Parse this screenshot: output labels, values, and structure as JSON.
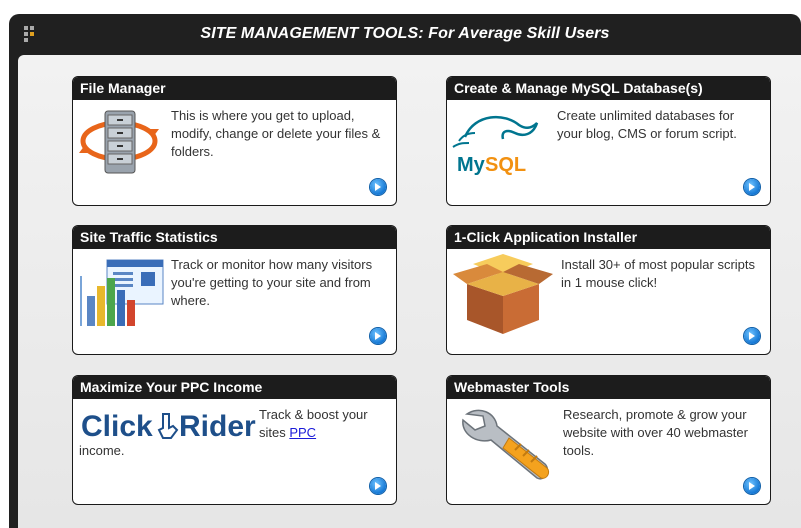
{
  "panel": {
    "title": "SITE MANAGEMENT TOOLS: For Average Skill Users"
  },
  "cards": [
    {
      "title": "File Manager",
      "text": "This is where you get to upload, modify, change or delete your files & folders.",
      "icon": "file-cabinet-icon"
    },
    {
      "title": "Create & Manage MySQL Database(s)",
      "text": "Create unlimited databases for your blog, CMS or forum script.",
      "icon": "mysql-logo",
      "logo_text": "MySQL"
    },
    {
      "title": "Site Traffic Statistics",
      "text": "Track or monitor how many visitors you're getting to your site and from where.",
      "icon": "bar-chart-icon"
    },
    {
      "title": "1-Click Application Installer",
      "text": "Install 30+ of most popular scripts in 1 mouse click!",
      "icon": "open-box-icon"
    },
    {
      "title": "Maximize Your PPC Income",
      "text_before": "Track & boost your sites ",
      "link": "PPC",
      "text_after": "income.",
      "icon": "clickrider-logo",
      "logo_text": "ClickRider"
    },
    {
      "title": "Webmaster Tools",
      "text": "Research, promote & grow your website with over 40 webmaster tools.",
      "icon": "wrench-icon"
    }
  ],
  "colors": {
    "panel_bg": "#202020",
    "card_header": "#1c1c1c",
    "arrow_blue": "#1477d4",
    "mysql_blue": "#00758f",
    "mysql_orange": "#f29111"
  }
}
